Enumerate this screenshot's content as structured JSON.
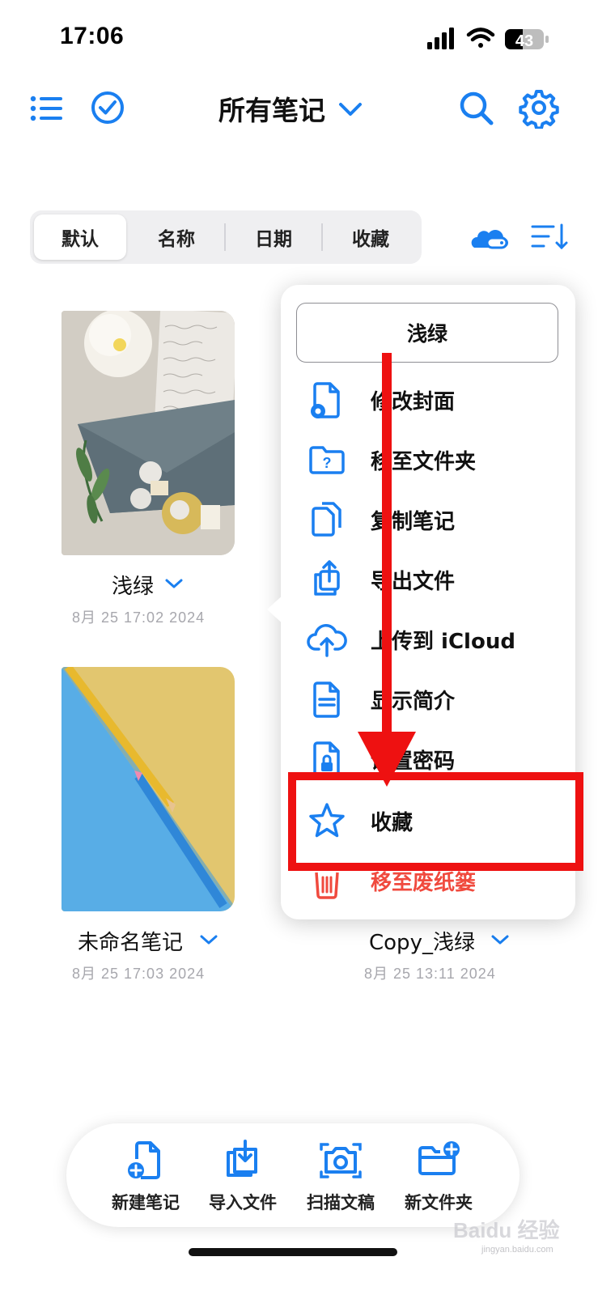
{
  "status_bar": {
    "time": "17:06",
    "battery": "43"
  },
  "header": {
    "title": "所有笔记"
  },
  "sort_tabs": [
    "默认",
    "名称",
    "日期",
    "收藏"
  ],
  "notes": [
    {
      "title": "浅绿",
      "date": "8月 25 17:02 2024"
    },
    {
      "title": "未命名笔记",
      "date": "8月 25 17:03 2024"
    },
    {
      "title": "Copy_浅绿",
      "date": "8月 25 13:11 2024"
    }
  ],
  "context_menu": {
    "note_name": "浅绿",
    "items": [
      {
        "label": "修改封面",
        "icon": "file-gear-icon"
      },
      {
        "label": "移至文件夹",
        "icon": "folder-question-icon"
      },
      {
        "label": "复制笔记",
        "icon": "copy-icon"
      },
      {
        "label": "导出文件",
        "icon": "export-icon"
      },
      {
        "label": "上传到 iCloud",
        "icon": "cloud-upload-icon"
      },
      {
        "label": "显示简介",
        "icon": "file-text-icon"
      },
      {
        "label": "设置密码",
        "icon": "file-lock-icon"
      },
      {
        "label": "收藏",
        "icon": "star-icon"
      },
      {
        "label": "移至废纸篓",
        "icon": "trash-icon"
      }
    ]
  },
  "toolbar": {
    "items": [
      {
        "label": "新建笔记",
        "icon": "new-note-icon"
      },
      {
        "label": "导入文件",
        "icon": "import-icon"
      },
      {
        "label": "扫描文稿",
        "icon": "camera-icon"
      },
      {
        "label": "新文件夹",
        "icon": "new-folder-icon"
      }
    ]
  },
  "watermark": {
    "brand": "Baidu 经验",
    "url": "jingyan.baidu.com"
  },
  "colors": {
    "accent": "#1a7ff0",
    "danger": "#f04a3e",
    "annotation": "#ee1111"
  }
}
